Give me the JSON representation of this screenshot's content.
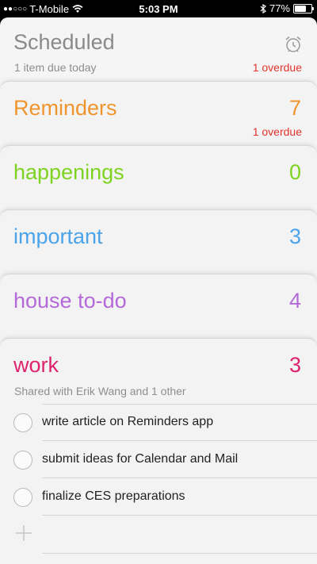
{
  "status": {
    "carrier": "T-Mobile",
    "signal_dots": "●●○○○",
    "time": "5:03 PM",
    "battery": "77%",
    "battery_level": 0.77
  },
  "scheduled": {
    "title": "Scheduled",
    "subtitle": "1 item due today",
    "overdue": "1 overdue",
    "icon": "alarm-clock-icon"
  },
  "lists": [
    {
      "name": "Reminders",
      "count": "7",
      "overdue": "1 overdue",
      "color": "#f0952d"
    },
    {
      "name": "happenings",
      "count": "0",
      "color": "#7ed321"
    },
    {
      "name": "important",
      "count": "3",
      "color": "#4ba3ea"
    },
    {
      "name": "house to-do",
      "count": "4",
      "color": "#b36ad8"
    },
    {
      "name": "work",
      "count": "3",
      "color": "#e0226d",
      "shared": "Shared with Erik Wang and 1 other"
    }
  ],
  "tasks": [
    "write article on Reminders app",
    "submit ideas for Calendar and Mail",
    "finalize CES preparations"
  ],
  "colors": {
    "overdue": "#e0342c",
    "subtitle": "#8e8e8e"
  }
}
